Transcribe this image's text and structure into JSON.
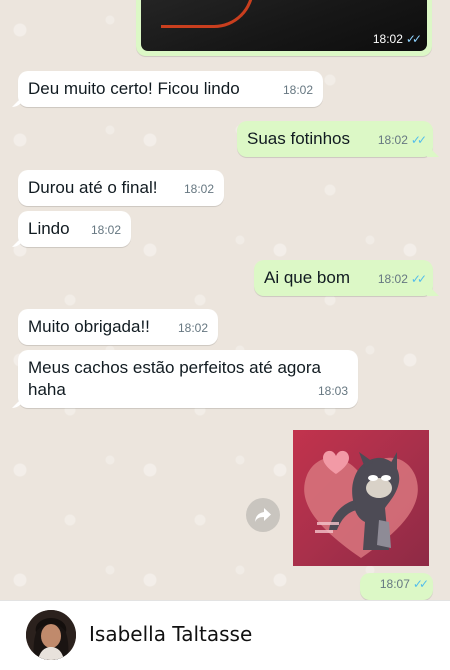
{
  "conversation": {
    "top_photo": {
      "time": "18:02",
      "ticks": "✓✓"
    },
    "messages": [
      {
        "dir": "in",
        "text": "Deu muito certo! Ficou lindo",
        "time": "18:02"
      },
      {
        "dir": "out",
        "text": "Suas fotinhos",
        "time": "18:02",
        "ticks": "✓✓"
      },
      {
        "dir": "in",
        "text": "Durou até o final!",
        "time": "18:02"
      },
      {
        "dir": "in",
        "text": "Lindo",
        "time": "18:02"
      },
      {
        "dir": "out",
        "text": "Ai que bom",
        "time": "18:02",
        "ticks": "✓✓"
      },
      {
        "dir": "in",
        "text": "Muito obrigada!!",
        "time": "18:02"
      },
      {
        "dir": "in",
        "text": "Meus cachos estão perfeitos até agora haha",
        "time": "18:03"
      }
    ],
    "sticker": {
      "icon": "tom-cat-heart-sticker",
      "time": "18:07",
      "ticks": "✓✓"
    },
    "forward_icon": "forward-arrow-icon"
  },
  "footer": {
    "username": "Isabella Taltasse",
    "avatar_icon": "profile-avatar"
  },
  "colors": {
    "incoming_bubble": "#ffffff",
    "outgoing_bubble": "#dcf8c6",
    "chat_background": "#ece5dd",
    "read_ticks": "#53bdeb",
    "timestamp": "#667781"
  }
}
